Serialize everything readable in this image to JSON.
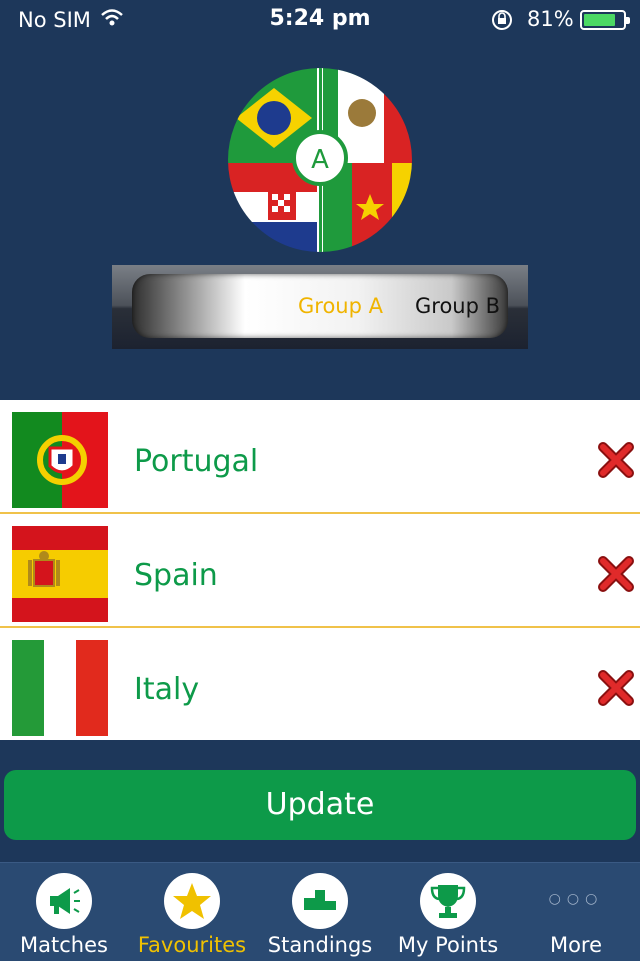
{
  "status": {
    "carrier": "No SIM",
    "time": "5:24 pm",
    "battery": "81%",
    "battery_level": 0.81
  },
  "logo": {
    "letter": "A"
  },
  "groups": {
    "tab_a": "Group A",
    "tab_b": "Group B",
    "selected": "Group A"
  },
  "favourites": [
    {
      "name": "Portugal"
    },
    {
      "name": "Spain"
    },
    {
      "name": "Italy"
    }
  ],
  "update_label": "Update",
  "tabs": [
    {
      "label": "Matches",
      "icon": "megaphone-icon"
    },
    {
      "label": "Favourites",
      "icon": "star-icon"
    },
    {
      "label": "Standings",
      "icon": "podium-icon"
    },
    {
      "label": "My Points",
      "icon": "trophy-icon"
    },
    {
      "label": "More",
      "icon": "more-dots-icon"
    }
  ],
  "colors": {
    "background": "#1d375a",
    "accent_green": "#0d9a49",
    "active_tab": "#f0c100",
    "selected_segment": "#f0b400"
  }
}
